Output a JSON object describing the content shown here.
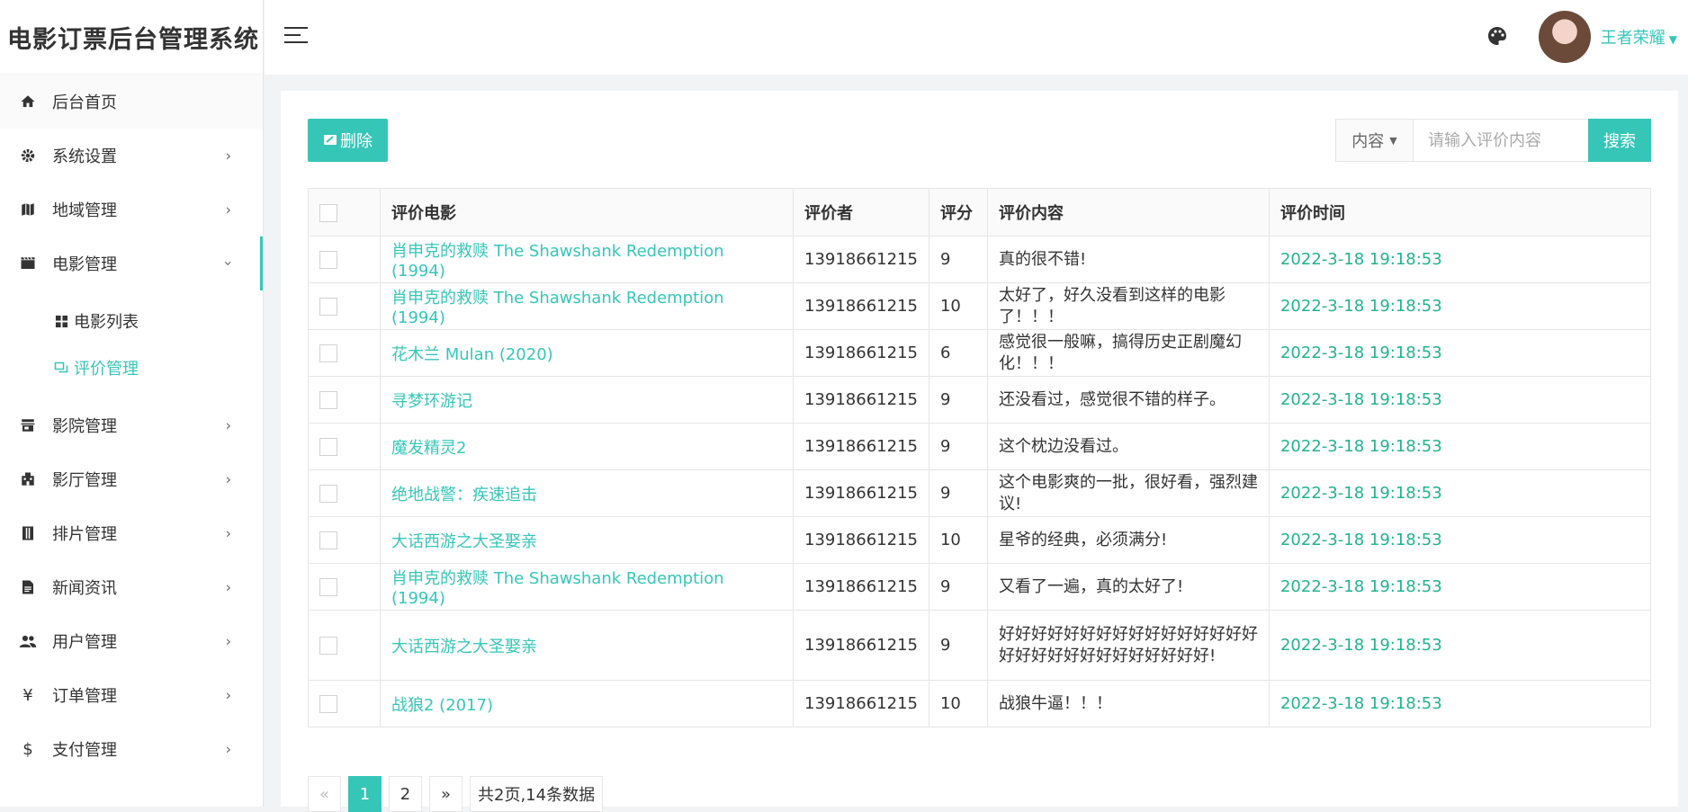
{
  "app": {
    "title": "电影订票后台管理系统"
  },
  "sidebar": {
    "items": [
      {
        "label": "后台首页"
      },
      {
        "label": "系统设置"
      },
      {
        "label": "地域管理"
      },
      {
        "label": "电影管理"
      },
      {
        "label": "影院管理"
      },
      {
        "label": "影厅管理"
      },
      {
        "label": "排片管理"
      },
      {
        "label": "新闻资讯"
      },
      {
        "label": "用户管理"
      },
      {
        "label": "订单管理"
      },
      {
        "label": "支付管理"
      }
    ],
    "submenu": [
      {
        "label": "电影列表"
      },
      {
        "label": "评价管理"
      }
    ]
  },
  "header": {
    "username": "王者荣耀"
  },
  "toolbar": {
    "delete_label": "删除",
    "search_field": "内容",
    "search_placeholder": "请输入评价内容",
    "search_label": "搜索"
  },
  "table": {
    "columns": [
      "评价电影",
      "评价者",
      "评分",
      "评价内容",
      "评价时间"
    ],
    "rows": [
      {
        "movie": "肖申克的救赎 The Shawshank Redemption (1994)",
        "user": "13918661215",
        "score": "9",
        "content": "真的很不错!",
        "time": "2022-3-18 19:18:53"
      },
      {
        "movie": "肖申克的救赎 The Shawshank Redemption (1994)",
        "user": "13918661215",
        "score": "10",
        "content": "太好了，好久没看到这样的电影了！！！",
        "time": "2022-3-18 19:18:53"
      },
      {
        "movie": "花木兰 Mulan (2020)",
        "user": "13918661215",
        "score": "6",
        "content": "感觉很一般嘛，搞得历史正剧魔幻化！！！",
        "time": "2022-3-18 19:18:53"
      },
      {
        "movie": "寻梦环游记",
        "user": "13918661215",
        "score": "9",
        "content": "还没看过，感觉很不错的样子。",
        "time": "2022-3-18 19:18:53"
      },
      {
        "movie": "魔发精灵2",
        "user": "13918661215",
        "score": "9",
        "content": "这个枕边没看过。",
        "time": "2022-3-18 19:18:53"
      },
      {
        "movie": "绝地战警：疾速追击",
        "user": "13918661215",
        "score": "9",
        "content": "这个电影爽的一批，很好看，强烈建议!",
        "time": "2022-3-18 19:18:53"
      },
      {
        "movie": "大话西游之大圣娶亲",
        "user": "13918661215",
        "score": "10",
        "content": "星爷的经典，必须满分!",
        "time": "2022-3-18 19:18:53"
      },
      {
        "movie": "肖申克的救赎 The Shawshank Redemption (1994)",
        "user": "13918661215",
        "score": "9",
        "content": "又看了一遍，真的太好了!",
        "time": "2022-3-18 19:18:53"
      },
      {
        "movie": "大话西游之大圣娶亲",
        "user": "13918661215",
        "score": "9",
        "content": "好好好好好好好好好好好好好好好好好好好好好好好好好好好好好!",
        "time": "2022-3-18 19:18:53"
      },
      {
        "movie": "战狼2 (2017)",
        "user": "13918661215",
        "score": "10",
        "content": "战狼牛逼！！！",
        "time": "2022-3-18 19:18:53"
      }
    ]
  },
  "pagination": {
    "prev": "«",
    "pages": [
      "1",
      "2"
    ],
    "next": "»",
    "info": "共2页,14条数据"
  }
}
